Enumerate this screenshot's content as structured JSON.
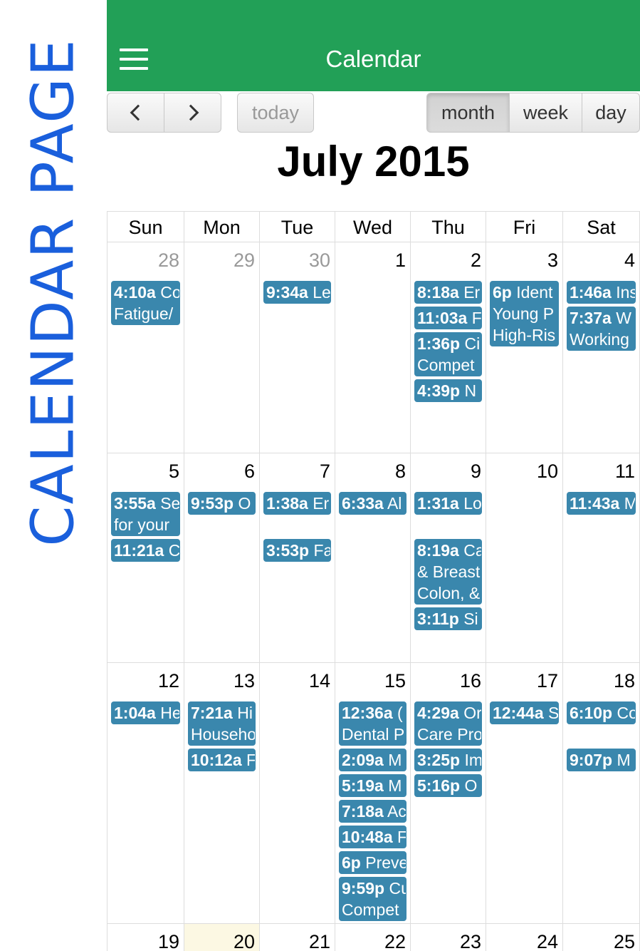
{
  "side_label": "CALENDAR PAGE",
  "app": {
    "title": "Calendar",
    "accent": "#22a057",
    "event_color": "#3a87ad"
  },
  "toolbar": {
    "today": "today",
    "views": [
      "month",
      "week",
      "day"
    ],
    "active_view": "month"
  },
  "month_title": "July 2015",
  "weekdays": [
    "Sun",
    "Mon",
    "Tue",
    "Wed",
    "Thu",
    "Fri",
    "Sat"
  ],
  "weeks": [
    [
      {
        "day": "28",
        "other": true,
        "events": [
          {
            "time": "4:10a",
            "text": "Co",
            "text2": "Fatigue/"
          }
        ]
      },
      {
        "day": "29",
        "other": true,
        "events": []
      },
      {
        "day": "30",
        "other": true,
        "events": [
          {
            "time": "9:34a",
            "text": "Le"
          }
        ]
      },
      {
        "day": "1",
        "events": []
      },
      {
        "day": "2",
        "events": [
          {
            "time": "8:18a",
            "text": "Er"
          },
          {
            "time": "11:03a",
            "text": "F"
          },
          {
            "time": "1:36p",
            "text": "Ci",
            "text2": "Compet"
          },
          {
            "time": "4:39p",
            "text": "N"
          }
        ]
      },
      {
        "day": "3",
        "events": [
          {
            "time": "6p",
            "text": "Ident",
            "text2": "Young P",
            "text3": "High-Ris"
          }
        ]
      },
      {
        "day": "4",
        "events": [
          {
            "time": "1:46a",
            "text": "Ins"
          },
          {
            "time": "7:37a",
            "text": "W",
            "text2": "Working"
          }
        ]
      }
    ],
    [
      {
        "day": "5",
        "events": [
          {
            "time": "3:55a",
            "text": "Se",
            "text2": "for your"
          },
          {
            "time": "11:21a",
            "text": "C"
          }
        ]
      },
      {
        "day": "6",
        "events": [
          {
            "time": "9:53p",
            "text": "O"
          }
        ]
      },
      {
        "day": "7",
        "events": [
          {
            "time": "1:38a",
            "text": "Er"
          },
          {
            "time": "3:53p",
            "text": "Fa",
            "gap": true
          }
        ]
      },
      {
        "day": "8",
        "events": [
          {
            "time": "6:33a",
            "text": "Al"
          }
        ]
      },
      {
        "day": "9",
        "events": [
          {
            "time": "1:31a",
            "text": "Lo"
          },
          {
            "time": "8:19a",
            "text": "Ca",
            "text2": "& Breast",
            "text3": "Colon, &",
            "gap": true
          },
          {
            "time": "3:11p",
            "text": "Si"
          }
        ]
      },
      {
        "day": "10",
        "events": []
      },
      {
        "day": "11",
        "events": [
          {
            "time": "11:43a",
            "text": "M"
          }
        ]
      }
    ],
    [
      {
        "day": "12",
        "events": [
          {
            "time": "1:04a",
            "text": "He"
          }
        ]
      },
      {
        "day": "13",
        "events": [
          {
            "time": "7:21a",
            "text": "Hi",
            "text2": "Househo"
          },
          {
            "time": "10:12a",
            "text": "F"
          }
        ]
      },
      {
        "day": "14",
        "events": []
      },
      {
        "day": "15",
        "events": [
          {
            "time": "12:36a",
            "text": "(",
            "text2": "Dental P"
          },
          {
            "time": "2:09a",
            "text": "M"
          },
          {
            "time": "5:19a",
            "text": "M"
          },
          {
            "time": "7:18a",
            "text": "Ac"
          },
          {
            "time": "10:48a",
            "text": "F"
          },
          {
            "time": "6p",
            "text": "Preve"
          },
          {
            "time": "9:59p",
            "text": "Cu",
            "text2": "Compet"
          }
        ]
      },
      {
        "day": "16",
        "events": [
          {
            "time": "4:29a",
            "text": "Or",
            "text2": "Care Pro"
          },
          {
            "time": "3:25p",
            "text": "Im"
          },
          {
            "time": "5:16p",
            "text": "O"
          }
        ]
      },
      {
        "day": "17",
        "events": [
          {
            "time": "12:44a",
            "text": "S"
          }
        ]
      },
      {
        "day": "18",
        "events": [
          {
            "time": "6:10p",
            "text": "Co"
          },
          {
            "time": "9:07p",
            "text": "M",
            "gap": true
          }
        ]
      }
    ],
    [
      {
        "day": "19",
        "events": []
      },
      {
        "day": "20",
        "today": true,
        "events": []
      },
      {
        "day": "21",
        "events": []
      },
      {
        "day": "22",
        "events": []
      },
      {
        "day": "23",
        "events": []
      },
      {
        "day": "24",
        "events": []
      },
      {
        "day": "25",
        "events": []
      }
    ]
  ]
}
